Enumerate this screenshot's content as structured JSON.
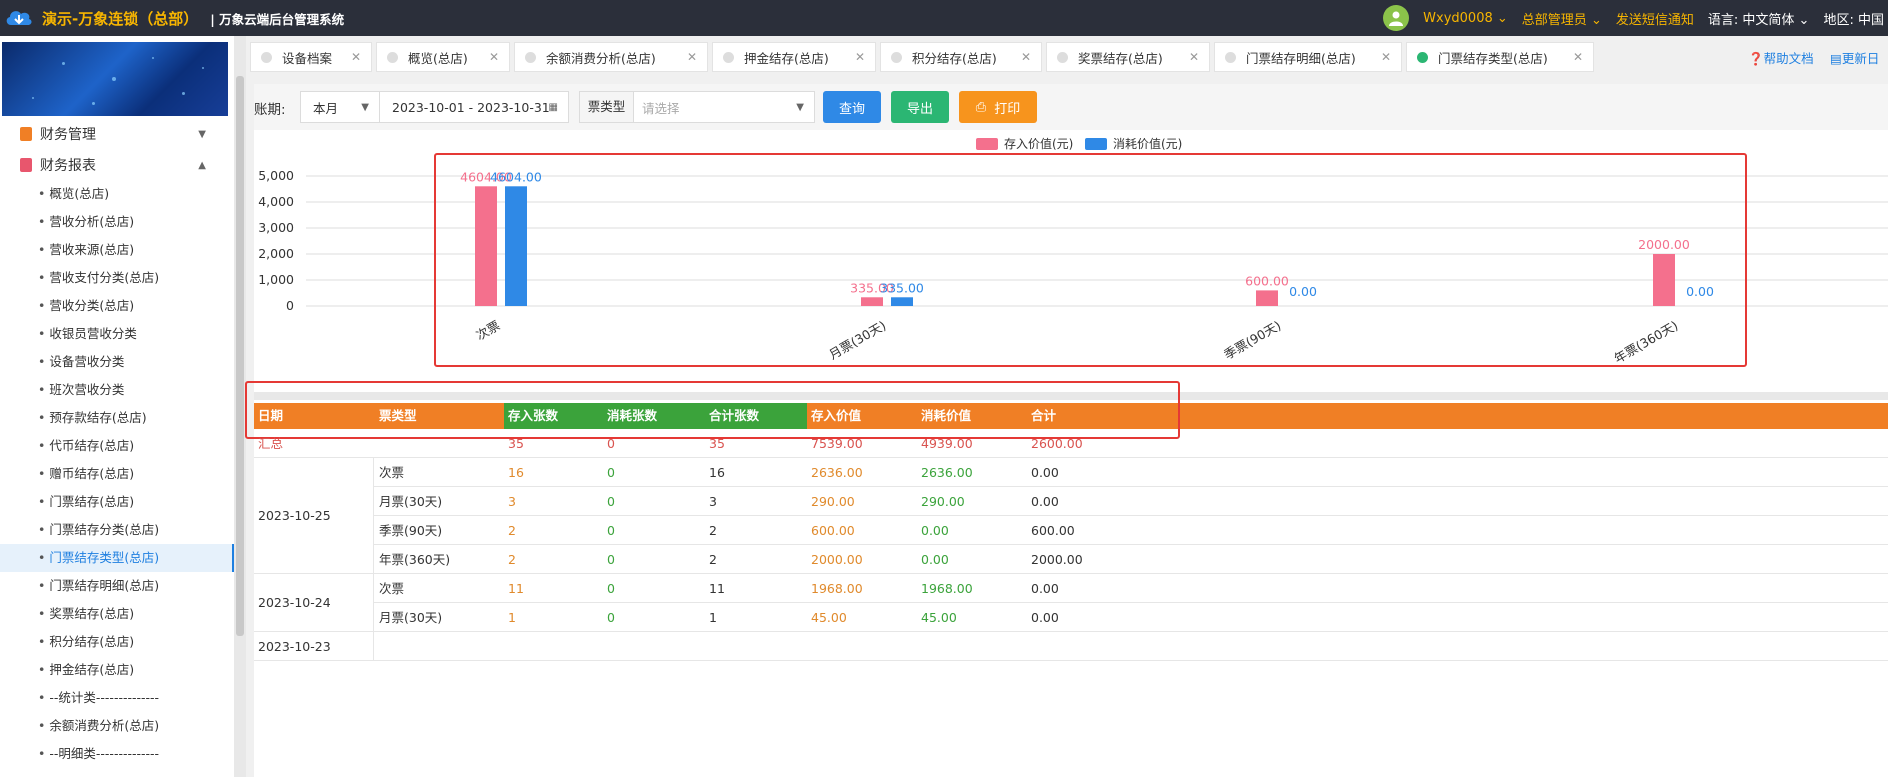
{
  "header": {
    "brand": "演示-万象连锁（总部）",
    "system_name": "| 万象云端后台管理系统",
    "user": "Wxyd0008",
    "role": "总部管理员",
    "sms": "发送短信通知",
    "lang_label": "语言:",
    "lang_value": "中文简体",
    "region_label": "地区:",
    "region_value": "中国"
  },
  "sidebar": {
    "groups": [
      {
        "label": "财务管理",
        "expanded": false
      },
      {
        "label": "财务报表",
        "expanded": true
      }
    ],
    "items": [
      "概览(总店)",
      "营收分析(总店)",
      "营收来源(总店)",
      "营收支付分类(总店)",
      "营收分类(总店)",
      "收银员营收分类",
      "设备营收分类",
      "班次营收分类",
      "预存款结存(总店)",
      "代币结存(总店)",
      "赠币结存(总店)",
      "门票结存(总店)",
      "门票结存分类(总店)",
      "门票结存类型(总店)",
      "门票结存明细(总店)",
      "奖票结存(总店)",
      "积分结存(总店)",
      "押金结存(总店)",
      "--统计类--------------",
      "余额消费分析(总店)",
      "--明细类--------------"
    ],
    "active_item": "门票结存类型(总店)"
  },
  "tabs": [
    {
      "label": "设备档案",
      "active": false
    },
    {
      "label": "概览(总店)",
      "active": false
    },
    {
      "label": "余额消费分析(总店)",
      "active": false
    },
    {
      "label": "押金结存(总店)",
      "active": false
    },
    {
      "label": "积分结存(总店)",
      "active": false
    },
    {
      "label": "奖票结存(总店)",
      "active": false
    },
    {
      "label": "门票结存明细(总店)",
      "active": false
    },
    {
      "label": "门票结存类型(总店)",
      "active": true
    }
  ],
  "help_links": {
    "docs": "帮助文档",
    "update_log": "更新日"
  },
  "filters": {
    "period_label": "账期:",
    "period_value": "本月",
    "date_range": "2023-10-01 - 2023-10-31",
    "type_label": "票类型",
    "type_placeholder": "请选择",
    "query_btn": "查询",
    "export_btn": "导出",
    "print_btn": "打印"
  },
  "colors": {
    "deposit": "#f4708d",
    "consume": "#2f89e6",
    "header_orange": "#f07f25",
    "header_green": "#3ba33b"
  },
  "chart_data": {
    "type": "bar",
    "categories": [
      "次票",
      "月票(30天)",
      "季票(90天)",
      "年票(360天)"
    ],
    "series": [
      {
        "name": "存入价值(元)",
        "values": [
          4604.0,
          335.0,
          600.0,
          2000.0
        ],
        "labels": [
          "4604.00",
          "335.00",
          "600.00",
          "2000.00"
        ]
      },
      {
        "name": "消耗价值(元)",
        "values": [
          4604.0,
          335.0,
          0.0,
          0.0
        ],
        "labels": [
          "4604.00",
          "335.00",
          "0.00",
          "0.00"
        ]
      }
    ],
    "yticks": [
      "5,000",
      "4,000",
      "3,000",
      "2,000",
      "1,000",
      "0"
    ],
    "ylim": [
      0,
      5000
    ],
    "legend_position": "top-center",
    "grid": true
  },
  "table": {
    "headers": [
      "日期",
      "票类型",
      "存入张数",
      "消耗张数",
      "合计张数",
      "存入价值",
      "消耗价值",
      "合计"
    ],
    "total": {
      "label": "汇总",
      "in_count": "35",
      "out_count": "0",
      "sum_count": "35",
      "in_value": "7539.00",
      "out_value": "4939.00",
      "sum_value": "2600.00"
    },
    "groups": [
      {
        "date": "2023-10-25",
        "rows": [
          {
            "type": "次票",
            "in_count": "16",
            "out_count": "0",
            "sum_count": "16",
            "in_value": "2636.00",
            "out_value": "2636.00",
            "sum_value": "0.00"
          },
          {
            "type": "月票(30天)",
            "in_count": "3",
            "out_count": "0",
            "sum_count": "3",
            "in_value": "290.00",
            "out_value": "290.00",
            "sum_value": "0.00"
          },
          {
            "type": "季票(90天)",
            "in_count": "2",
            "out_count": "0",
            "sum_count": "2",
            "in_value": "600.00",
            "out_value": "0.00",
            "sum_value": "600.00"
          },
          {
            "type": "年票(360天)",
            "in_count": "2",
            "out_count": "0",
            "sum_count": "2",
            "in_value": "2000.00",
            "out_value": "0.00",
            "sum_value": "2000.00"
          }
        ]
      },
      {
        "date": "2023-10-24",
        "rows": [
          {
            "type": "次票",
            "in_count": "11",
            "out_count": "0",
            "sum_count": "11",
            "in_value": "1968.00",
            "out_value": "1968.00",
            "sum_value": "0.00"
          },
          {
            "type": "月票(30天)",
            "in_count": "1",
            "out_count": "0",
            "sum_count": "1",
            "in_value": "45.00",
            "out_value": "45.00",
            "sum_value": "0.00"
          }
        ]
      },
      {
        "date": "2023-10-23",
        "rows": []
      }
    ]
  }
}
